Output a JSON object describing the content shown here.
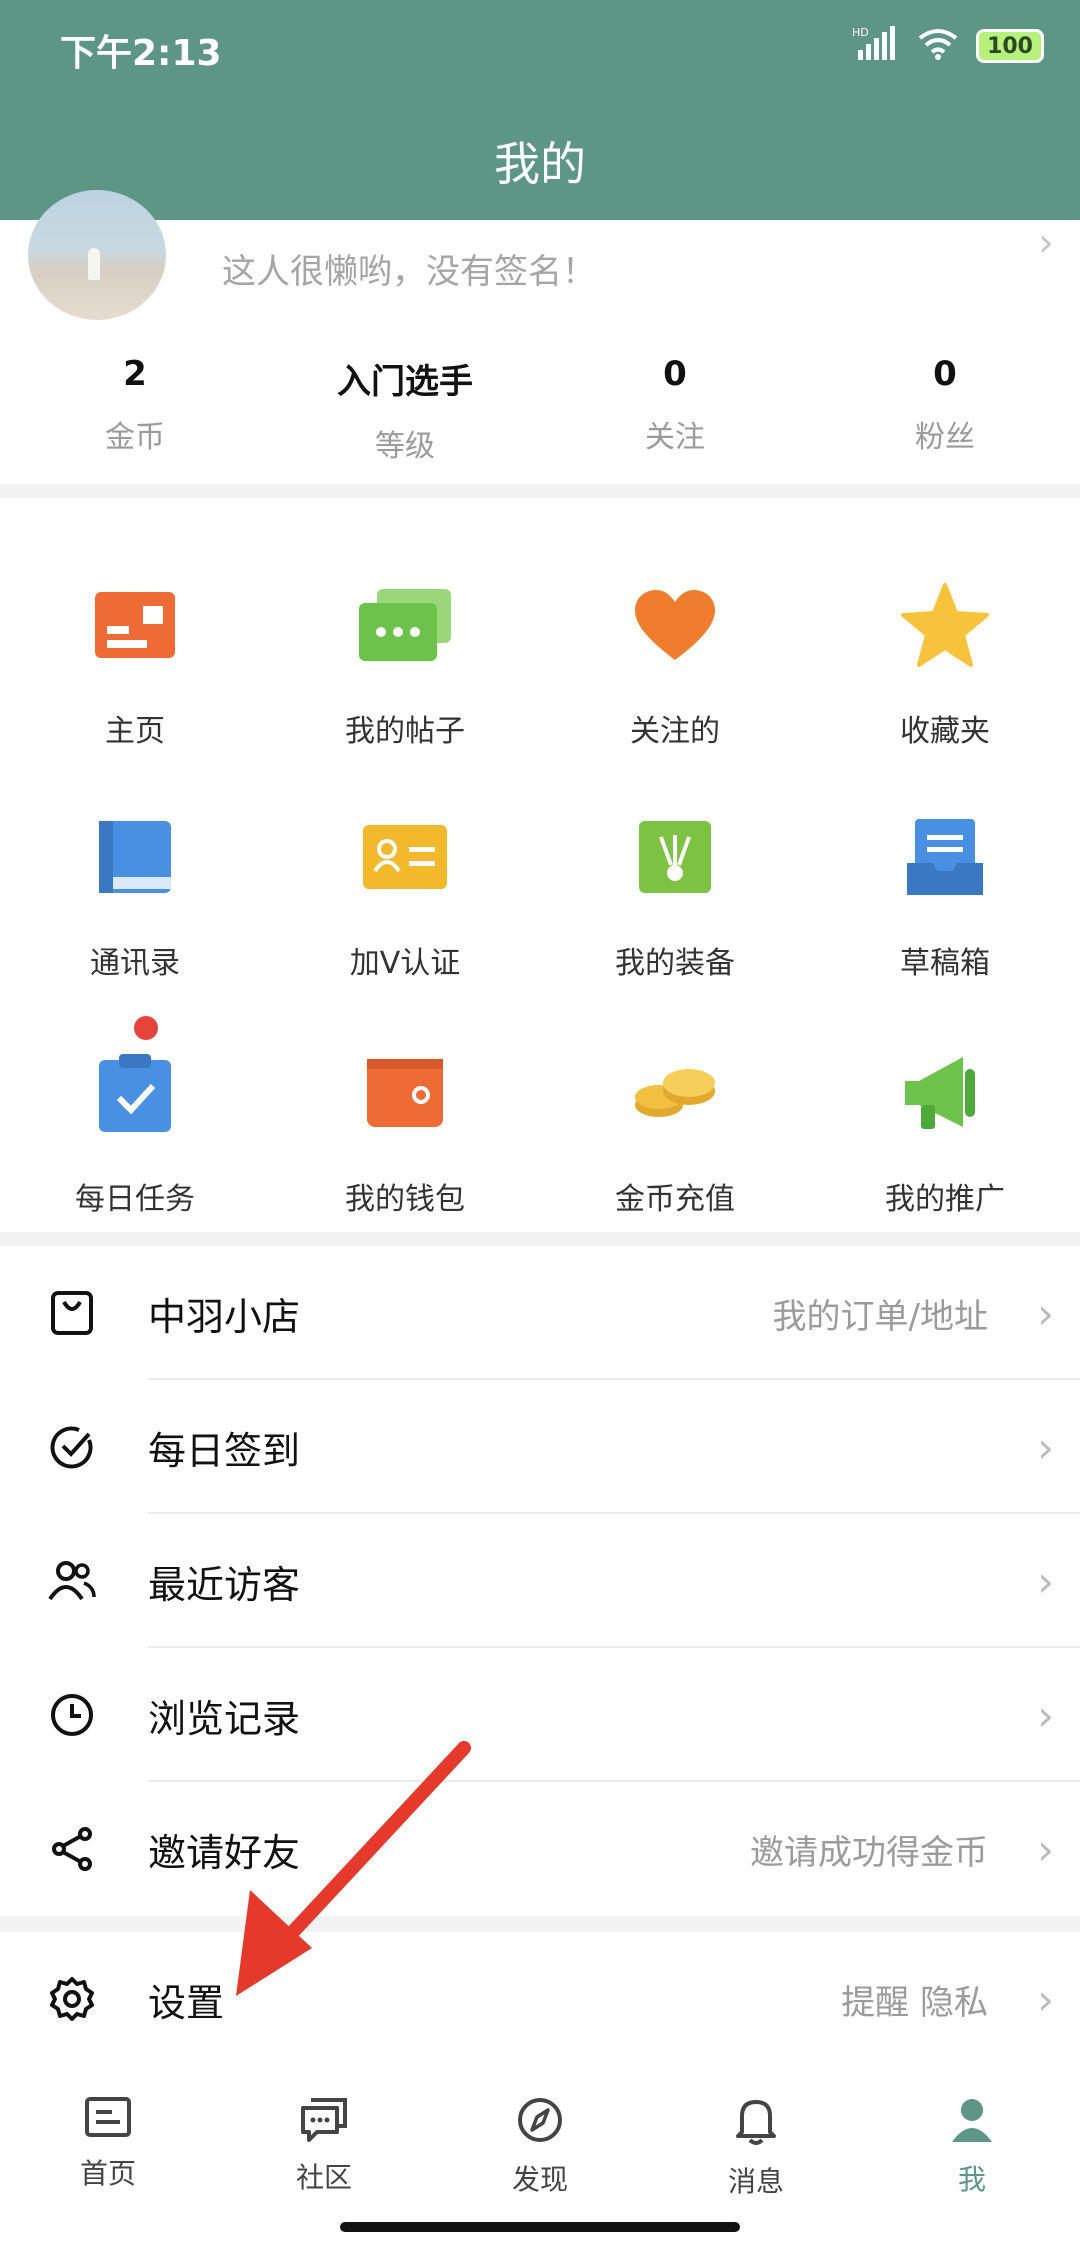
{
  "status_bar": {
    "time": "下午2:13",
    "network": "HD",
    "battery": "100"
  },
  "header": {
    "title": "我的"
  },
  "profile": {
    "signature": "这人很懒哟，没有签名！",
    "stats": [
      {
        "value": "2",
        "label": "金币"
      },
      {
        "value": "入门选手",
        "label": "等级"
      },
      {
        "value": "0",
        "label": "关注"
      },
      {
        "value": "0",
        "label": "粉丝"
      }
    ]
  },
  "grid": {
    "rows": [
      [
        {
          "label": "主页",
          "icon": "homepage-card-icon",
          "color": "#ee6b35"
        },
        {
          "label": "我的帖子",
          "icon": "chat-cards-icon",
          "color": "#6cc24a"
        },
        {
          "label": "关注的",
          "icon": "heart-icon",
          "color": "#ef7d2d"
        },
        {
          "label": "收藏夹",
          "icon": "star-icon",
          "color": "#f7c23c"
        }
      ],
      [
        {
          "label": "通讯录",
          "icon": "book-icon",
          "color": "#4a90e2"
        },
        {
          "label": "加V认证",
          "icon": "id-card-icon",
          "color": "#f3b92c"
        },
        {
          "label": "我的装备",
          "icon": "shuttlecock-icon",
          "color": "#7dc242"
        },
        {
          "label": "草稿箱",
          "icon": "drafts-tray-icon",
          "color": "#4a90e2"
        }
      ],
      [
        {
          "label": "每日任务",
          "icon": "clipboard-check-icon",
          "color": "#4a90e2",
          "badge": true
        },
        {
          "label": "我的钱包",
          "icon": "wallet-icon",
          "color": "#ee6b35"
        },
        {
          "label": "金币充值",
          "icon": "coins-icon",
          "color": "#f1bf41"
        },
        {
          "label": "我的推广",
          "icon": "megaphone-icon",
          "color": "#6cc24a"
        }
      ]
    ]
  },
  "list": [
    {
      "label": "中羽小店",
      "extra": "我的订单/地址",
      "icon": "shopping-bag-icon"
    },
    {
      "label": "每日签到",
      "extra": "",
      "icon": "check-circle-icon"
    },
    {
      "label": "最近访客",
      "extra": "",
      "icon": "visitors-icon"
    },
    {
      "label": "浏览记录",
      "extra": "",
      "icon": "clock-icon"
    },
    {
      "label": "邀请好友",
      "extra": "邀请成功得金币",
      "icon": "share-icon"
    }
  ],
  "settings": {
    "label": "设置",
    "extra": "提醒  隐私",
    "icon": "gear-icon"
  },
  "tabbar": [
    {
      "label": "首页",
      "icon": "home-list-icon",
      "active": false
    },
    {
      "label": "社区",
      "icon": "community-chat-icon",
      "active": false
    },
    {
      "label": "发现",
      "icon": "compass-icon",
      "active": false
    },
    {
      "label": "消息",
      "icon": "bell-icon",
      "active": false
    },
    {
      "label": "我",
      "icon": "person-icon",
      "active": true
    }
  ],
  "colors": {
    "primary": "#5e9685",
    "annotation_arrow": "#e5392b"
  }
}
